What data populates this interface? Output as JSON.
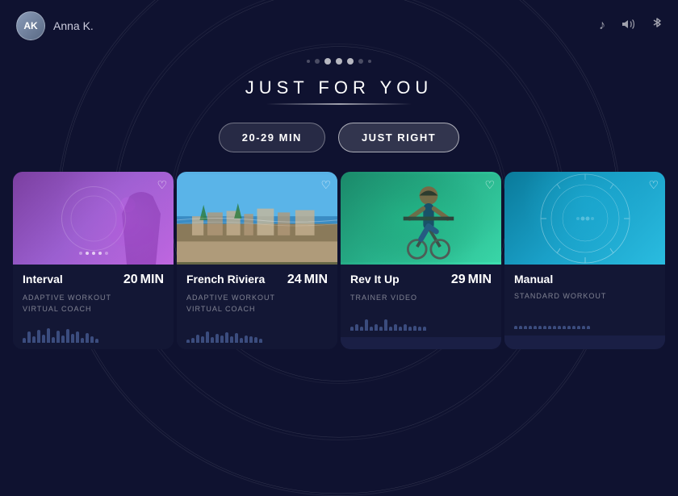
{
  "app": {
    "user": {
      "initials": "AK",
      "name": "Anna K."
    }
  },
  "topbar": {
    "icons": {
      "music": "♪",
      "volume": "🔊",
      "bluetooth": "⚡"
    }
  },
  "dots": [
    {
      "type": "small"
    },
    {
      "type": "normal"
    },
    {
      "type": "active"
    },
    {
      "type": "active"
    },
    {
      "type": "active"
    },
    {
      "type": "normal"
    },
    {
      "type": "small"
    }
  ],
  "section": {
    "title": "JUST FOR YOU",
    "filters": [
      {
        "label": "20-29 MIN",
        "active": false
      },
      {
        "label": "JUST RIGHT",
        "active": true
      }
    ]
  },
  "cards": [
    {
      "id": 1,
      "title": "Interval",
      "duration": "20",
      "unit": "MIN",
      "tags": [
        "ADAPTIVE WORKOUT",
        "VIRTUAL COACH"
      ],
      "type": "adaptive",
      "waveform": [
        6,
        14,
        8,
        16,
        10,
        18,
        7,
        15,
        9,
        17,
        11,
        14,
        6,
        12,
        8,
        15
      ]
    },
    {
      "id": 2,
      "title": "French Riviera",
      "duration": "24",
      "unit": "MIN",
      "tags": [
        "ADAPTIVE WORKOUT",
        "VIRTUAL COACH"
      ],
      "type": "scenic",
      "waveform": [
        4,
        6,
        10,
        8,
        14,
        7,
        11,
        9,
        13,
        8,
        12,
        6,
        9,
        8,
        7,
        6
      ]
    },
    {
      "id": 3,
      "title": "Rev It Up",
      "duration": "29",
      "unit": "MIN",
      "tags": [
        "TRAINER VIDEO"
      ],
      "type": "trainer",
      "waveform": [
        5,
        8,
        5,
        14,
        5,
        8,
        5,
        14,
        5,
        8,
        5,
        8,
        5,
        6,
        5,
        7
      ]
    },
    {
      "id": 4,
      "title": "Manual",
      "duration": "",
      "unit": "",
      "tags": [
        "STANDARD WORKOUT"
      ],
      "type": "manual",
      "waveform": [
        4,
        4,
        4,
        4,
        4,
        4,
        4,
        4,
        4,
        4,
        4,
        4,
        4,
        4,
        4,
        4
      ]
    }
  ]
}
